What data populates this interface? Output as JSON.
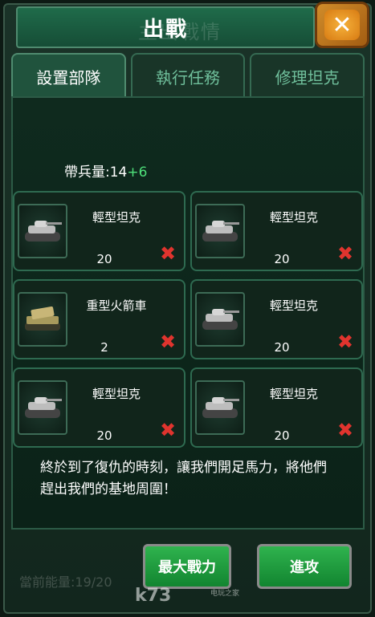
{
  "header": {
    "title": "出戰",
    "ghost_title": "主出戰情"
  },
  "tabs": [
    {
      "label": "設置部隊",
      "active": true
    },
    {
      "label": "執行任務",
      "active": false
    },
    {
      "label": "修理坦克",
      "active": false
    }
  ],
  "capacity": {
    "label": "帶兵量:14",
    "bonus": "+6"
  },
  "units": [
    {
      "name": "輕型坦克",
      "count": "20",
      "icon": "tank-icon"
    },
    {
      "name": "輕型坦克",
      "count": "20",
      "icon": "tank-icon"
    },
    {
      "name": "重型火箭車",
      "count": "2",
      "icon": "rocket-vehicle-icon"
    },
    {
      "name": "輕型坦克",
      "count": "20",
      "icon": "tank-icon"
    },
    {
      "name": "輕型坦克",
      "count": "20",
      "icon": "tank-icon"
    },
    {
      "name": "輕型坦克",
      "count": "20",
      "icon": "tank-icon"
    }
  ],
  "message": "終於到了復仇的時刻，讓我們開足馬力，將他們趕出我們的基地周圍！",
  "energy_label": "當前能量:19/20",
  "buttons": {
    "max_power": "最大戰力",
    "attack": "進攻"
  },
  "watermark": {
    "text": "k73",
    "sub": "电玩之家"
  },
  "colors": {
    "accent_green": "#4ee07a",
    "close_orange": "#d77a12",
    "remove_red": "#e0342e"
  }
}
